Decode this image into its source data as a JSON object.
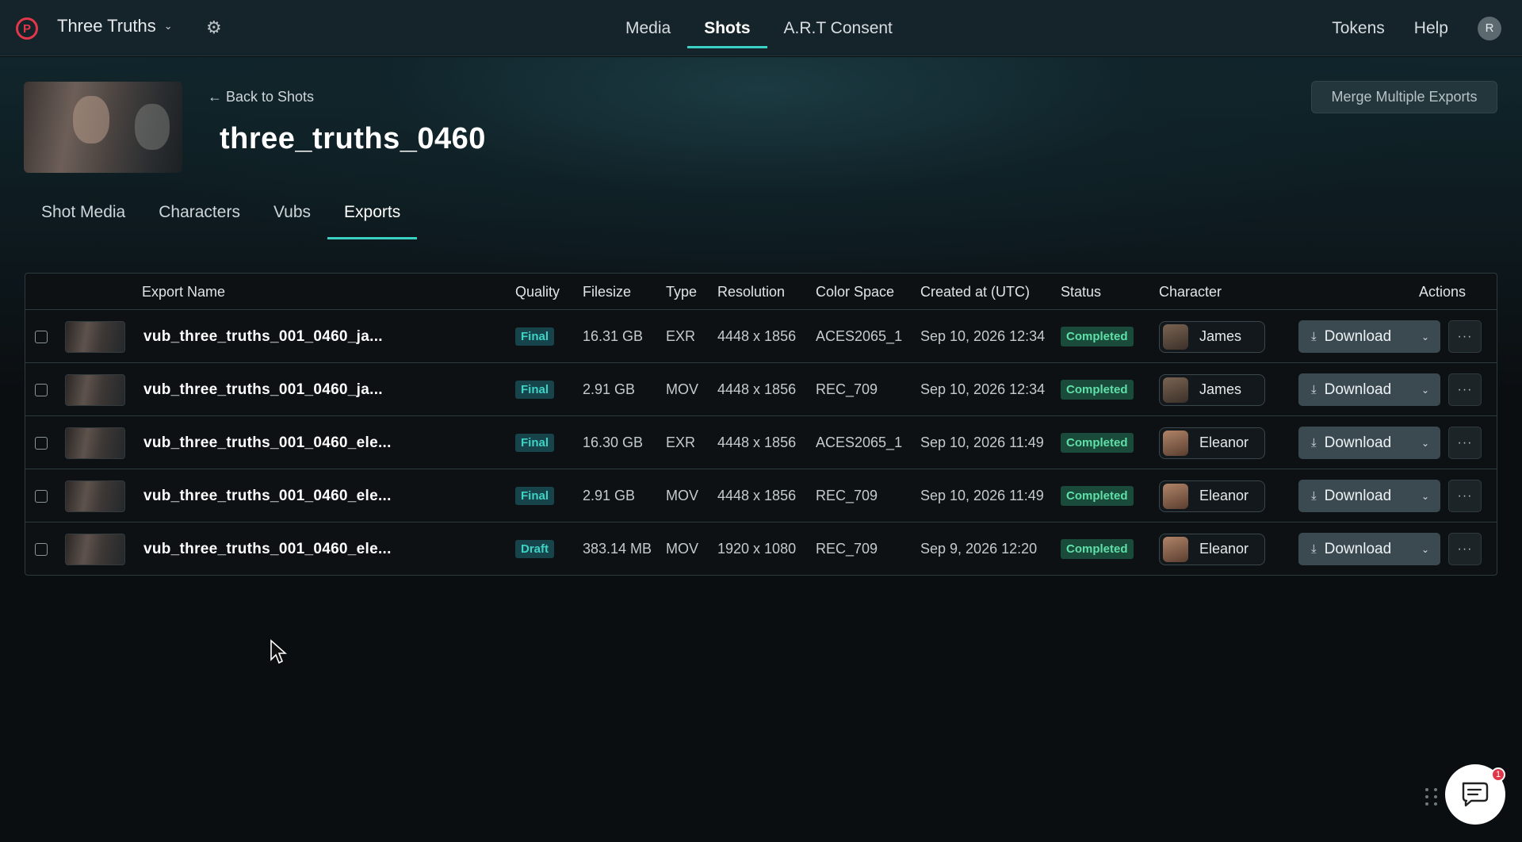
{
  "topbar": {
    "logo_letter": "P",
    "project_name": "Three Truths",
    "nav": [
      "Media",
      "Shots",
      "A.R.T Consent"
    ],
    "active_nav": "Shots",
    "tokens_label": "Tokens",
    "help_label": "Help",
    "avatar_initial": "R"
  },
  "header": {
    "back_label": "← Back to Shots",
    "title": "three_truths_0460",
    "merge_label": "Merge Multiple Exports"
  },
  "subtabs": [
    "Shot Media",
    "Characters",
    "Vubs",
    "Exports"
  ],
  "active_subtab": "Exports",
  "table": {
    "headers": {
      "export_name": "Export Name",
      "quality": "Quality",
      "filesize": "Filesize",
      "type": "Type",
      "resolution": "Resolution",
      "color_space": "Color Space",
      "created": "Created at (UTC)",
      "status": "Status",
      "character": "Character",
      "actions": "Actions"
    },
    "download_label": "Download",
    "more_label": "···",
    "rows": [
      {
        "name": "vub_three_truths_001_0460_ja...",
        "quality": "Final",
        "filesize": "16.31 GB",
        "type": "EXR",
        "resolution": "4448 x 1856",
        "color_space": "ACES2065_1",
        "created": "Sep 10, 2026 12:34",
        "status": "Completed",
        "character": "James"
      },
      {
        "name": "vub_three_truths_001_0460_ja...",
        "quality": "Final",
        "filesize": "2.91 GB",
        "type": "MOV",
        "resolution": "4448 x 1856",
        "color_space": "REC_709",
        "created": "Sep 10, 2026 12:34",
        "status": "Completed",
        "character": "James"
      },
      {
        "name": "vub_three_truths_001_0460_ele...",
        "quality": "Final",
        "filesize": "16.30 GB",
        "type": "EXR",
        "resolution": "4448 x 1856",
        "color_space": "ACES2065_1",
        "created": "Sep 10, 2026 11:49",
        "status": "Completed",
        "character": "Eleanor"
      },
      {
        "name": "vub_three_truths_001_0460_ele...",
        "quality": "Final",
        "filesize": "2.91 GB",
        "type": "MOV",
        "resolution": "4448 x 1856",
        "color_space": "REC_709",
        "created": "Sep 10, 2026 11:49",
        "status": "Completed",
        "character": "Eleanor"
      },
      {
        "name": "vub_three_truths_001_0460_ele...",
        "quality": "Draft",
        "filesize": "383.14 MB",
        "type": "MOV",
        "resolution": "1920 x 1080",
        "color_space": "REC_709",
        "created": "Sep 9, 2026 12:20",
        "status": "Completed",
        "character": "Eleanor"
      }
    ]
  },
  "chat": {
    "badge_count": "1"
  },
  "colors": {
    "accent": "#3ad1c4",
    "brand": "#e0384a",
    "status_completed": "#5fe0a8"
  }
}
